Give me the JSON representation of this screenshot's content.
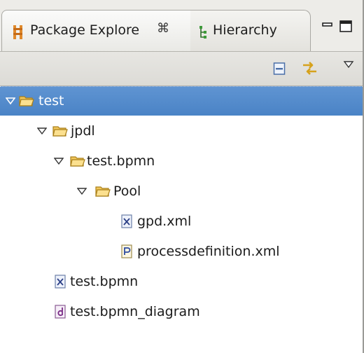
{
  "tabs": [
    {
      "label": "Package Explore",
      "icon": "package-explorer-icon",
      "close_glyph": "⌘",
      "active": true
    },
    {
      "label": "Hierarchy",
      "icon": "hierarchy-icon",
      "active": false
    }
  ],
  "window_controls": [
    "minimize-icon",
    "maximize-icon"
  ],
  "toolbar": [
    "collapse-all-icon",
    "link-with-editor-icon",
    "view-menu-icon"
  ],
  "tree": [
    {
      "label": "test",
      "depth": 0,
      "expanded": true,
      "icon": "project-folder-icon",
      "selected": true
    },
    {
      "label": "jpdl",
      "depth": 1,
      "expanded": true,
      "icon": "folder-icon"
    },
    {
      "label": "test.bpmn",
      "depth": 2,
      "expanded": true,
      "icon": "folder-icon"
    },
    {
      "label": "Pool",
      "depth": 3,
      "expanded": true,
      "icon": "folder-icon"
    },
    {
      "label": "gpd.xml",
      "depth": 4,
      "icon": "xml-file-icon"
    },
    {
      "label": "processdefinition.xml",
      "depth": 4,
      "icon": "process-definition-file-icon"
    },
    {
      "label": "test.bpmn",
      "depth": 1,
      "icon": "xml-file-icon"
    },
    {
      "label": "test.bpmn_diagram",
      "depth": 1,
      "icon": "diagram-file-icon"
    }
  ],
  "colors": {
    "selection": "#4f88cb",
    "folder": "#f2c75c",
    "tab_bar": "#edece8"
  }
}
